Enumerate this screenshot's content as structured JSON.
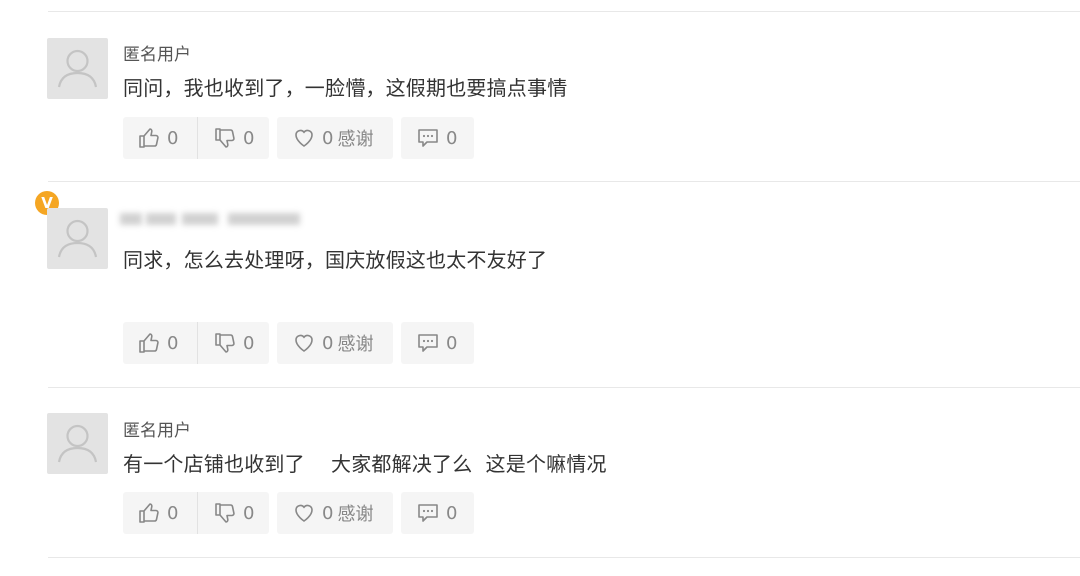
{
  "comments": [
    {
      "username": "匿名用户",
      "text": "同问，我也收到了，一脸懵，这假期也要搞点事情",
      "likes": "0",
      "dislikes": "0",
      "thanks_count": "0",
      "thanks_label": "感谢",
      "replies": "0"
    },
    {
      "username": "",
      "verified_badge": "V",
      "text": "同求，怎么去处理呀，国庆放假这也太不友好了",
      "likes": "0",
      "dislikes": "0",
      "thanks_count": "0",
      "thanks_label": "感谢",
      "replies": "0"
    },
    {
      "username": "匿名用户",
      "text": "有一个店铺也收到了    大家都解决了么  这是个嘛情况",
      "likes": "0",
      "dislikes": "0",
      "thanks_count": "0",
      "thanks_label": "感谢",
      "replies": "0"
    }
  ],
  "icons": {
    "like": "thumbs-up-icon",
    "dislike": "thumbs-down-icon",
    "thanks": "heart-icon",
    "reply": "comment-icon",
    "avatar": "default-user-icon"
  },
  "colors": {
    "badge": "#f5a623",
    "button_bg": "#f5f5f5",
    "muted_text": "#888888"
  }
}
